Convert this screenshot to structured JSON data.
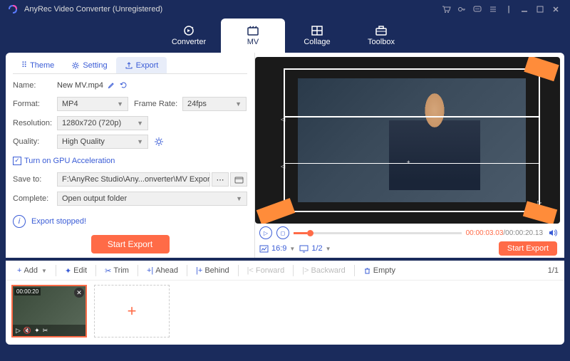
{
  "titlebar": {
    "title": "AnyRec Video Converter (Unregistered)"
  },
  "nav": {
    "converter": "Converter",
    "mv": "MV",
    "collage": "Collage",
    "toolbox": "Toolbox"
  },
  "subtabs": {
    "theme": "Theme",
    "setting": "Setting",
    "export": "Export"
  },
  "form": {
    "name_label": "Name:",
    "name_value": "New MV.mp4",
    "format_label": "Format:",
    "format_value": "MP4",
    "framerate_label": "Frame Rate:",
    "framerate_value": "24fps",
    "resolution_label": "Resolution:",
    "resolution_value": "1280x720 (720p)",
    "quality_label": "Quality:",
    "quality_value": "High Quality",
    "gpu_label": "Turn on GPU Acceleration",
    "saveto_label": "Save to:",
    "saveto_value": "F:\\AnyRec Studio\\Any...onverter\\MV Exported",
    "complete_label": "Complete:",
    "complete_value": "Open output folder"
  },
  "status": {
    "msg": "Export stopped!"
  },
  "buttons": {
    "start_export": "Start Export"
  },
  "preview": {
    "time_current": "00:00:03.03",
    "time_total": "00:00:20.13",
    "aspect": "16:9",
    "page": "1/2"
  },
  "toolbar": {
    "add": "Add",
    "edit": "Edit",
    "trim": "Trim",
    "ahead": "Ahead",
    "behind": "Behind",
    "forward": "Forward",
    "backward": "Backward",
    "empty": "Empty",
    "pager": "1/1"
  },
  "clip": {
    "duration": "00:00:20"
  }
}
